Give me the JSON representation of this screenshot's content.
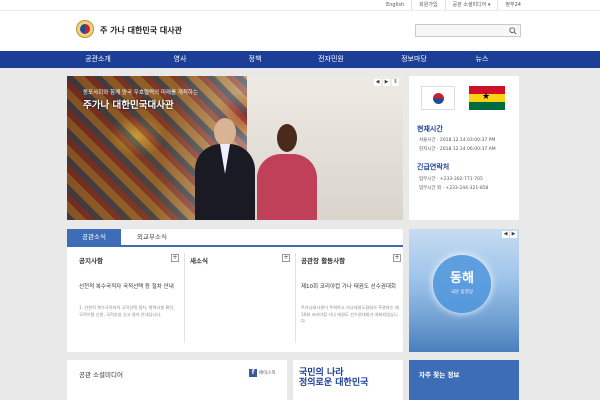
{
  "topbar": {
    "links": [
      "English",
      "회원가입",
      "공관 소셜미디어 ▾",
      "정부24"
    ]
  },
  "header": {
    "title": "주 가나 대한민국 대사관"
  },
  "gnb": {
    "items": [
      "공관소개",
      "영사",
      "정책",
      "전자민원",
      "정보마당",
      "뉴스"
    ]
  },
  "hero": {
    "subtitle": "동포사회와 함께 양국 우호협력의 미래를 개척하는",
    "title": "주가나 대한민국대사관",
    "controls": [
      "◀",
      "▶",
      "Ⅱ"
    ]
  },
  "side": {
    "time_title": "현재시간",
    "time_rows": [
      "서울시간 · 2018.12.14 03:00:37 PM",
      "현지시간 · 2018.12.14 06:00:37 AM"
    ],
    "emergency_title": "긴급연락처",
    "emergency_rows": [
      "업무시간 · +233-302-771-705",
      "업무시간 외 · +233-244-321-858"
    ]
  },
  "news": {
    "tabs": [
      "공관소식",
      "외교부소식"
    ],
    "cols": [
      {
        "title": "공지사항",
        "headline": "선천적 복수국적자 국적선택 등 절차 안내",
        "body": "1. 선천적 복수국적자의 국적선택 절차, 병역사항 확인, 국적이탈 신청, 국적상실 신고 절차 안내입니다."
      },
      {
        "title": "새소식",
        "headline": "",
        "body": ""
      },
      {
        "title": "공관장 활동사항",
        "headline": "제10회 코리아컵 가나 태권도 선수권대회",
        "body": "주가나대사관이 주최하고 가나태권도협회가 주관하는 제10회 코리아컵 가나 태권도 선수권대회가 개최되었습니다."
      }
    ]
  },
  "promo": {
    "title": "동해",
    "subtitle": "국문 동영상",
    "controls": [
      "◀",
      "▶"
    ]
  },
  "social": {
    "title": "공관 소셜미디어",
    "fb_label": "페이스북"
  },
  "banner": {
    "line1": "국민의 나라",
    "line2": "정의로운 대한민국"
  },
  "freq": {
    "title": "자주 찾는 정보"
  },
  "colors": {
    "nav": "#1c3e96",
    "tab_active": "#3e6db8",
    "page_bg": "#e9e9e9"
  }
}
